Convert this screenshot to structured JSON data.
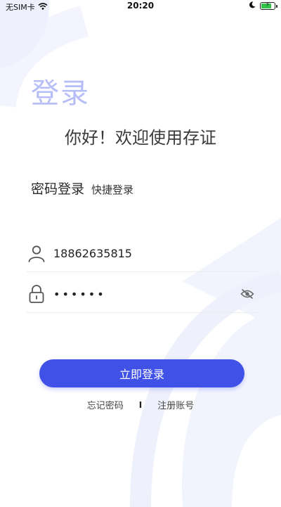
{
  "status_bar": {
    "carrier": "无SIM卡",
    "time": "20:20",
    "battery_level": 0.8,
    "battery_color": "#35c24a",
    "icons": [
      "wifi-icon",
      "moon-icon",
      "battery-charging-icon"
    ]
  },
  "page": {
    "title": "登录",
    "welcome": "你好！欢迎使用存证"
  },
  "tabs": {
    "password_login": "密码登录",
    "quick_login": "快捷登录"
  },
  "form": {
    "username_value": "18862635815",
    "password_value": "••••••",
    "user_icon": "user-icon",
    "lock_icon": "lock-icon",
    "eye_icon": "eye-off-icon"
  },
  "actions": {
    "login_label": "立即登录",
    "forgot_password": "忘记密码",
    "separator": "I",
    "register": "注册账号"
  },
  "colors": {
    "accent": "#3f51e6",
    "title": "#b7bdf6",
    "decor": "#eef0fc"
  }
}
